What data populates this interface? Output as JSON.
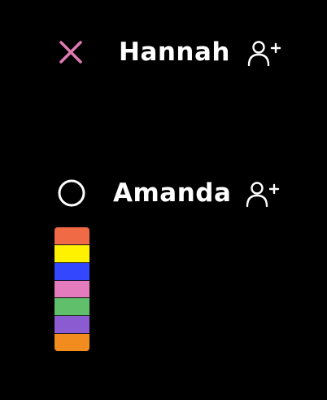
{
  "players": [
    {
      "name": "Hannah",
      "marker": "x-icon",
      "marker_color": "#e07bb5",
      "action_icon": "add-user-icon"
    },
    {
      "name": "Amanda",
      "marker": "circle-icon",
      "marker_color": "#ffffff",
      "action_icon": "add-user-icon"
    }
  ],
  "color_palette": {
    "swatches": [
      {
        "name": "orange-red",
        "color": "#ef6a45"
      },
      {
        "name": "yellow",
        "color": "#fff200"
      },
      {
        "name": "blue",
        "color": "#3347ff"
      },
      {
        "name": "pink",
        "color": "#e47bbd"
      },
      {
        "name": "green",
        "color": "#5fbf6b"
      },
      {
        "name": "purple",
        "color": "#8b5bd1"
      },
      {
        "name": "orange",
        "color": "#f28c1f"
      }
    ]
  }
}
